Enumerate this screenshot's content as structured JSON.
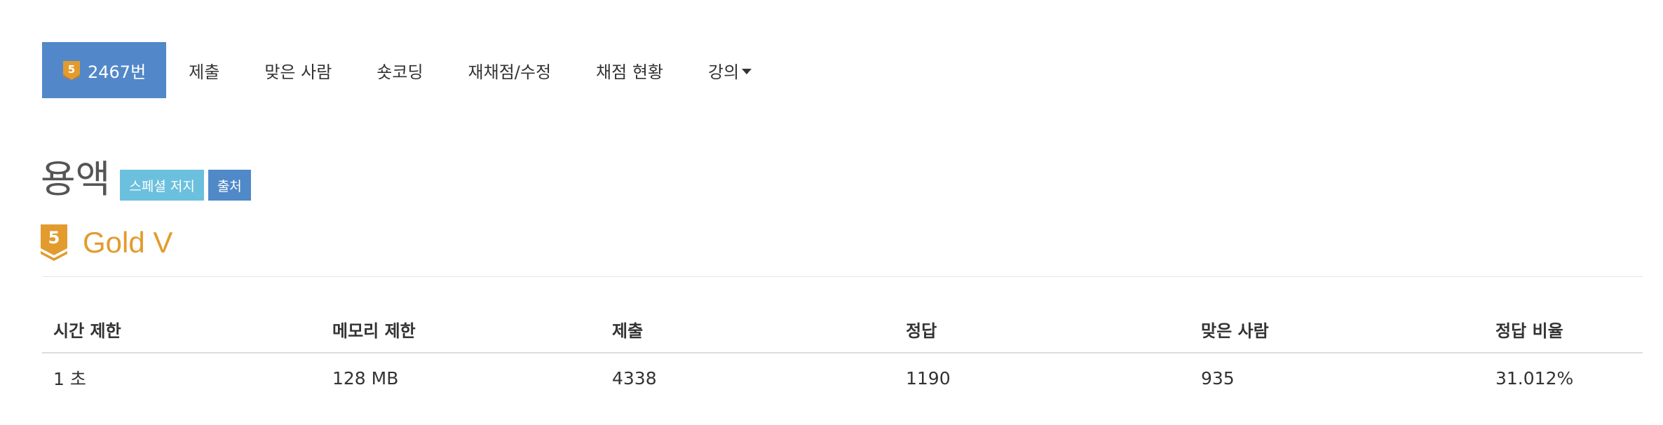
{
  "tabs": {
    "items": [
      {
        "label": "2467번",
        "active": true,
        "tier_icon": "gold-tier-5-icon",
        "tier_digit": "5"
      },
      {
        "label": "제출"
      },
      {
        "label": "맞은 사람"
      },
      {
        "label": "숏코딩"
      },
      {
        "label": "재채점/수정"
      },
      {
        "label": "채점 현황"
      },
      {
        "label": "강의",
        "dropdown": true
      }
    ]
  },
  "problem": {
    "title": "용액",
    "labels": {
      "special_judge": "스페셜 저지",
      "source": "출처"
    },
    "tier": {
      "digit": "5",
      "name": "Gold V",
      "color": "#e39b2e"
    }
  },
  "info_table": {
    "headers": {
      "time_limit": "시간 제한",
      "memory_limit": "메모리 제한",
      "submissions": "제출",
      "accepted": "정답",
      "solvers": "맞은 사람",
      "ratio": "정답 비율"
    },
    "values": {
      "time_limit": "1 초",
      "memory_limit": "128 MB",
      "submissions": "4338",
      "accepted": "1190",
      "solvers": "935",
      "ratio": "31.012%"
    }
  },
  "colors": {
    "active_tab": "#5288c9",
    "label_info": "#6bc0de",
    "label_primary": "#4f89c8",
    "tier_gold": "#e39b2e"
  }
}
